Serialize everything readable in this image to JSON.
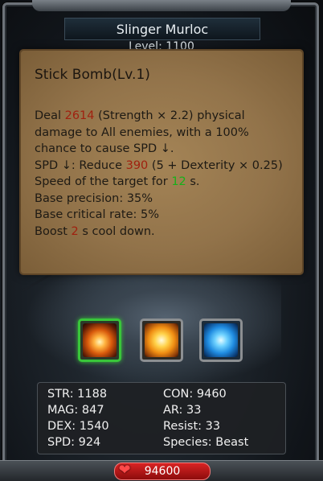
{
  "header": {
    "name": "Slinger Murloc",
    "level": "Level: 1100"
  },
  "skill_popup": {
    "title": "Stick Bomb(Lv.1)",
    "line1_a": "Deal ",
    "line1_dmg": "2614",
    "line1_b": " (Strength × 2.2) physical",
    "line2": "damage to All enemies, with a 100%",
    "line3": "chance to cause SPD ↓.",
    "line4_a": "SPD ↓: Reduce ",
    "line4_val": "390",
    "line4_b": " (5 + Dexterity × 0.25)",
    "line5_a": "Speed of the target for ",
    "line5_val": "12",
    "line5_b": " s.",
    "line6": "Base precision: 35%",
    "line7": "Base critical rate: 5%",
    "line8_a": "Boost ",
    "line8_val": "2",
    "line8_b": " s cool down."
  },
  "skills": [
    {
      "icon": "fire-burst-icon",
      "selected": true
    },
    {
      "icon": "explosion-icon",
      "selected": false
    },
    {
      "icon": "ice-totem-icon",
      "selected": false
    }
  ],
  "stats": {
    "str": "STR: 1188",
    "mag": "MAG: 847",
    "dex": "DEX: 1540",
    "spd": "SPD: 924",
    "con": "CON: 9460",
    "ar": "AR: 33",
    "resist": "Resist: 33",
    "species": "Species: Beast"
  },
  "hp": {
    "icon": "heart-icon",
    "value": "94600"
  },
  "colors": {
    "highlight_red": "#a0210f",
    "highlight_green": "#17b01a",
    "selected_border": "#39c63a"
  }
}
